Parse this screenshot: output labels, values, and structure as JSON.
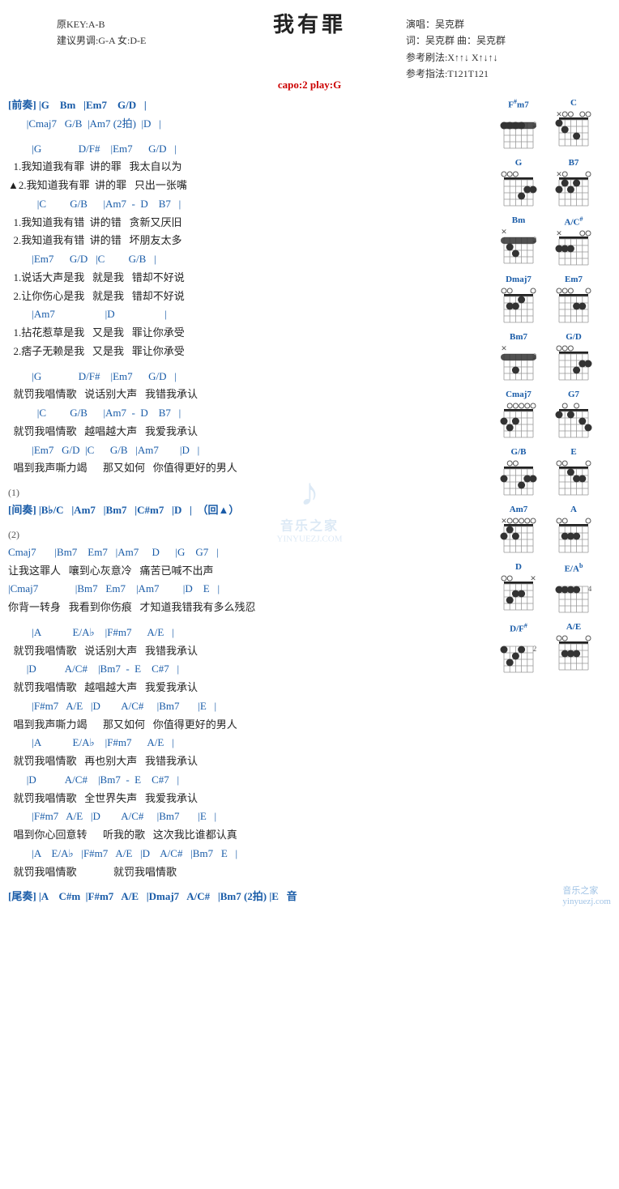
{
  "page": {
    "title": "我有罪",
    "meta_left": {
      "line1": "原KEY:A-B",
      "line2": "建议男调:G-A 女:D-E"
    },
    "capo": "capo:2 play:G",
    "meta_right": {
      "singer": "演唱：吴克群",
      "lyricist": "词：吴克群  曲：吴克群",
      "strum1": "参考刷法:X↑↑↓ X↑↓↑↓",
      "strum2": "参考指法:T121T121"
    }
  },
  "chords": [
    {
      "name": "F#m7",
      "fret_start": 2,
      "barre": true,
      "dots": [
        [
          2,
          1
        ],
        [
          2,
          2
        ],
        [
          2,
          3
        ],
        [
          2,
          4
        ]
      ]
    },
    {
      "name": "C",
      "fret_start": 0,
      "dots": [
        [
          2,
          2
        ],
        [
          3,
          4
        ],
        [
          1,
          1
        ]
      ]
    },
    {
      "name": "G",
      "fret_start": 0,
      "dots": [
        [
          3,
          6
        ],
        [
          2,
          5
        ],
        [
          3,
          4
        ]
      ]
    },
    {
      "name": "B7",
      "fret_start": 0,
      "dots": [
        [
          2,
          1
        ],
        [
          1,
          2
        ],
        [
          2,
          3
        ],
        [
          1,
          4
        ]
      ]
    },
    {
      "name": "Bm",
      "fret_start": 2,
      "barre": true,
      "dots": [
        [
          2,
          1
        ],
        [
          2,
          2
        ],
        [
          2,
          3
        ],
        [
          2,
          4
        ],
        [
          4,
          3
        ],
        [
          3,
          2
        ]
      ]
    },
    {
      "name": "A/C#",
      "fret_start": 0,
      "dots": []
    },
    {
      "name": "Dmaj7",
      "fret_start": 0,
      "dots": []
    },
    {
      "name": "Em7",
      "fret_start": 0,
      "dots": []
    },
    {
      "name": "Bm7",
      "fret_start": 0,
      "dots": []
    },
    {
      "name": "G/D",
      "fret_start": 0,
      "dots": []
    },
    {
      "name": "Cmaj7",
      "fret_start": 0,
      "dots": []
    },
    {
      "name": "G7",
      "fret_start": 0,
      "dots": []
    },
    {
      "name": "G/B",
      "fret_start": 0,
      "dots": []
    },
    {
      "name": "E",
      "fret_start": 0,
      "dots": []
    },
    {
      "name": "Am7",
      "fret_start": 0,
      "dots": []
    },
    {
      "name": "A",
      "fret_start": 0,
      "dots": []
    },
    {
      "name": "D",
      "fret_start": 0,
      "dots": []
    },
    {
      "name": "E/Ab",
      "fret_start": 0,
      "dots": []
    },
    {
      "name": "D/F#",
      "fret_start": 0,
      "dots": []
    },
    {
      "name": "A/E",
      "fret_start": 0,
      "dots": []
    }
  ],
  "lyrics": [
    {
      "type": "section_chord",
      "text": "[前奏] |G    Bm   |Em7    G/D   |"
    },
    {
      "type": "chord",
      "text": "       |Cmaj7   G/B  |Am7 (2拍)  |D   |"
    },
    {
      "type": "empty"
    },
    {
      "type": "chord",
      "text": "         |G              D/F#    |Em7      G/D   |"
    },
    {
      "type": "lyric",
      "text": "  1.我知道我有罪  讲的罪   我太自以为"
    },
    {
      "type": "lyric",
      "text": "▲2.我知道我有罪  讲的罪   只出一张嘴"
    },
    {
      "type": "chord",
      "text": "           |C         G/B      |Am7  -  D    B7   |"
    },
    {
      "type": "lyric",
      "text": "  1.我知道我有错  讲的错   贪新又厌旧"
    },
    {
      "type": "lyric",
      "text": "  2.我知道我有错  讲的错   坏朋友太多"
    },
    {
      "type": "chord",
      "text": "         |Em7      G/D   |C         G/B   |"
    },
    {
      "type": "lyric",
      "text": "  1.说话大声是我   就是我   错却不好说"
    },
    {
      "type": "lyric",
      "text": "  2.让你伤心是我   就是我   错却不好说"
    },
    {
      "type": "chord",
      "text": "         |Am7                   |D                   |"
    },
    {
      "type": "lyric",
      "text": "  1.拈花惹草是我   又是我   罪让你承受"
    },
    {
      "type": "lyric",
      "text": "  2.痞子无赖是我   又是我   罪让你承受"
    },
    {
      "type": "empty"
    },
    {
      "type": "chord",
      "text": "         |G              D/F#    |Em7      G/D   |"
    },
    {
      "type": "lyric",
      "text": "  就罚我唱情歌   说话别大声   我错我承认"
    },
    {
      "type": "chord",
      "text": "           |C         G/B      |Am7  -  D    B7   |"
    },
    {
      "type": "lyric",
      "text": "  就罚我唱情歌   越唱越大声   我爱我承认"
    },
    {
      "type": "chord",
      "text": "         |Em7   G/D  |C      G/B   |Am7        |D   |"
    },
    {
      "type": "lyric",
      "text": "  唱到我声嘶力竭      那又如何   你值得更好的男人"
    },
    {
      "type": "empty"
    },
    {
      "type": "comment",
      "text": "(1)"
    },
    {
      "type": "section_chord",
      "text": "[间奏] |B♭/C   |Am7   |Bm7   |C#m7   |D   |  （回▲）"
    },
    {
      "type": "empty"
    },
    {
      "type": "comment",
      "text": "(2)"
    },
    {
      "type": "chord",
      "text": "Cmaj7       |Bm7    Em7   |Am7     D      |G    G7   |"
    },
    {
      "type": "lyric",
      "text": "让我这罪人   嚷到心灰意冷   痛苦已喊不出声"
    },
    {
      "type": "chord",
      "text": "|Cmaj7              |Bm7   Em7    |Am7         |D    E   |"
    },
    {
      "type": "lyric",
      "text": "你背一转身   我看到你伤痕   才知道我错我有多么残忍"
    },
    {
      "type": "empty"
    },
    {
      "type": "chord",
      "text": "         |A            E/A♭    |F#m7      A/E   |"
    },
    {
      "type": "lyric",
      "text": "  就罚我唱情歌   说话别大声   我错我承认"
    },
    {
      "type": "chord",
      "text": "       |D           A/C#    |Bm7  -  E    C#7   |"
    },
    {
      "type": "lyric",
      "text": "  就罚我唱情歌   越唱越大声   我爱我承认"
    },
    {
      "type": "chord",
      "text": "         |F#m7   A/E   |D        A/C#     |Bm7       |E   |"
    },
    {
      "type": "lyric",
      "text": "  唱到我声嘶力竭      那又如何   你值得更好的男人"
    },
    {
      "type": "chord",
      "text": "         |A            E/A♭    |F#m7      A/E   |"
    },
    {
      "type": "lyric",
      "text": "  就罚我唱情歌   再也别大声   我错我承认"
    },
    {
      "type": "chord",
      "text": "       |D           A/C#    |Bm7  -  E    C#7   |"
    },
    {
      "type": "lyric",
      "text": "  就罚我唱情歌   全世界失声   我爱我承认"
    },
    {
      "type": "chord",
      "text": "         |F#m7   A/E   |D        A/C#     |Bm7       |E   |"
    },
    {
      "type": "lyric",
      "text": "  唱到你心回意转      听我的歌   这次我比谁都认真"
    },
    {
      "type": "chord",
      "text": "         |A    E/A♭   |F#m7   A/E   |D    A/C#   |Bm7   E   |"
    },
    {
      "type": "lyric",
      "text": "  就罚我唱情歌              就罚我唱情歌"
    },
    {
      "type": "empty"
    },
    {
      "type": "section_chord",
      "text": "[尾奏] |A    C#m  |F#m7   A/E   |Dmaj7   A/C#   |Bm7 (2拍) |E   音"
    }
  ],
  "watermark": {
    "icon": "♪",
    "text": "音乐之家",
    "url": "YINYUEZJ.COM"
  }
}
